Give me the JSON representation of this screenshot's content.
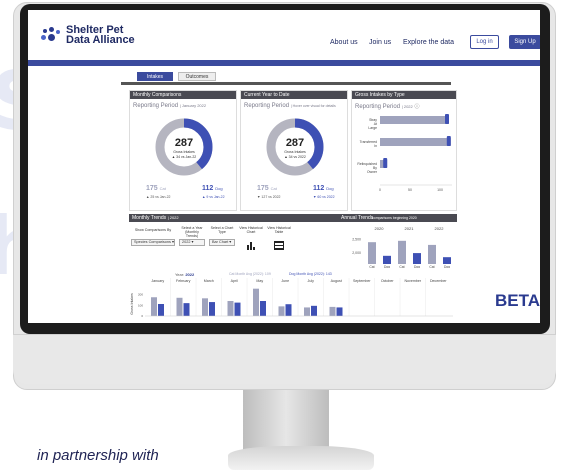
{
  "nav": {
    "brand_line1": "Shelter Pet",
    "brand_line2": "Data Alliance",
    "links": [
      "About us",
      "Join us",
      "Explore the data"
    ],
    "login": "Log in",
    "signup": "Sign Up"
  },
  "tabs": [
    "Intakes",
    "Outcomes"
  ],
  "panels": {
    "monthly": {
      "title": "Monthly Comparisons",
      "reporting": "Reporting Period",
      "period": "January 2022",
      "total": "287",
      "total_label": "Gross Intakes",
      "total_change": "▲ 34 vs Jan-22",
      "cat_value": "175",
      "cat_label": "Cat",
      "cat_change": "▲ 25 vs Jan-22",
      "dog_value": "112",
      "dog_label": "Dog",
      "dog_change": "▲ 9 vs Jan-22"
    },
    "ytd": {
      "title": "Current Year to Date",
      "reporting": "Reporting Period",
      "period": "Hover over visual for details",
      "total": "287",
      "total_label": "Gross Intakes",
      "total_change": "▲ 34 vs 2022",
      "cat_value": "175",
      "cat_label": "Cat",
      "cat_change": "▼ 127 vs 2022",
      "dog_value": "112",
      "dog_label": "Dog",
      "dog_change": "▼ 60 vs 2022"
    },
    "gross": {
      "title": "Gross Intakes by Type",
      "reporting": "Reporting Period",
      "period": "2022",
      "types": [
        "Stray At Large",
        "Transferred In",
        "Relinquished By Owner"
      ],
      "ticks": [
        "0",
        "50",
        "100"
      ]
    },
    "trends": {
      "title": "Monthly Trends",
      "period": "2022",
      "controls": [
        {
          "label": "Show Comparisons By",
          "value": "Species Comparisons ▾"
        },
        {
          "label": "Select a Year (Monthly Trends)",
          "value": "2022 ▾"
        },
        {
          "label": "Select a Chart Type",
          "value": "Bar Chart ▾"
        },
        {
          "label": "View Historical Chart",
          "value": ""
        },
        {
          "label": "View Historical Table",
          "value": ""
        }
      ],
      "year_label": "Year:",
      "year_value": "2022",
      "legend_cat": "Cat Month Avg (2022): 109",
      "legend_dog": "Dog Month Avg (2022): 143",
      "months": [
        "January",
        "February",
        "March",
        "April",
        "May",
        "June",
        "July",
        "August",
        "September",
        "October",
        "November",
        "December"
      ],
      "y_axis": "Gross Intakes",
      "y_ticks": [
        "200",
        "100",
        "0"
      ]
    },
    "annual": {
      "title": "Annual Trends",
      "subtitle": "comparisons beginning 2020",
      "years": [
        "2020",
        "2021",
        "2022"
      ],
      "cats": [
        "Cat",
        "Dog",
        "Cat",
        "Dog",
        "Cat",
        "Dog"
      ],
      "y_ticks": [
        "2,500",
        "2,000"
      ]
    }
  },
  "chart_data": [
    {
      "type": "bar",
      "categories": [
        "Stray At Large",
        "Transferred In",
        "Relinquished By Owner"
      ],
      "series": [
        {
          "values": [
            115,
            118,
            12
          ]
        }
      ],
      "xlim": [
        0,
        120
      ]
    },
    {
      "type": "bar",
      "categories": [
        "January",
        "February",
        "March",
        "April",
        "May",
        "June",
        "July",
        "August"
      ],
      "series": [
        {
          "name": "Cat",
          "values": [
            175,
            170,
            165,
            140,
            255,
            90,
            80,
            85
          ]
        },
        {
          "name": "Dog",
          "values": [
            112,
            120,
            130,
            125,
            140,
            110,
            95,
            80
          ]
        }
      ],
      "ylabel": "Gross Intakes",
      "ylim": [
        0,
        280
      ]
    },
    {
      "type": "bar",
      "categories": [
        "Cat 2020",
        "Dog 2020",
        "Cat 2021",
        "Dog 2021",
        "Cat 2022",
        "Dog 2022"
      ],
      "values": [
        2400,
        1900,
        2450,
        2000,
        2300,
        1850
      ],
      "ylim": [
        1600,
        2700
      ]
    }
  ],
  "colors": {
    "primary": "#3b4b9e",
    "cat": "#9fa3bd",
    "dog": "#3e50b4",
    "panel_header": "#4a4a52"
  },
  "beta": "BETA",
  "partner": "in partnership with"
}
